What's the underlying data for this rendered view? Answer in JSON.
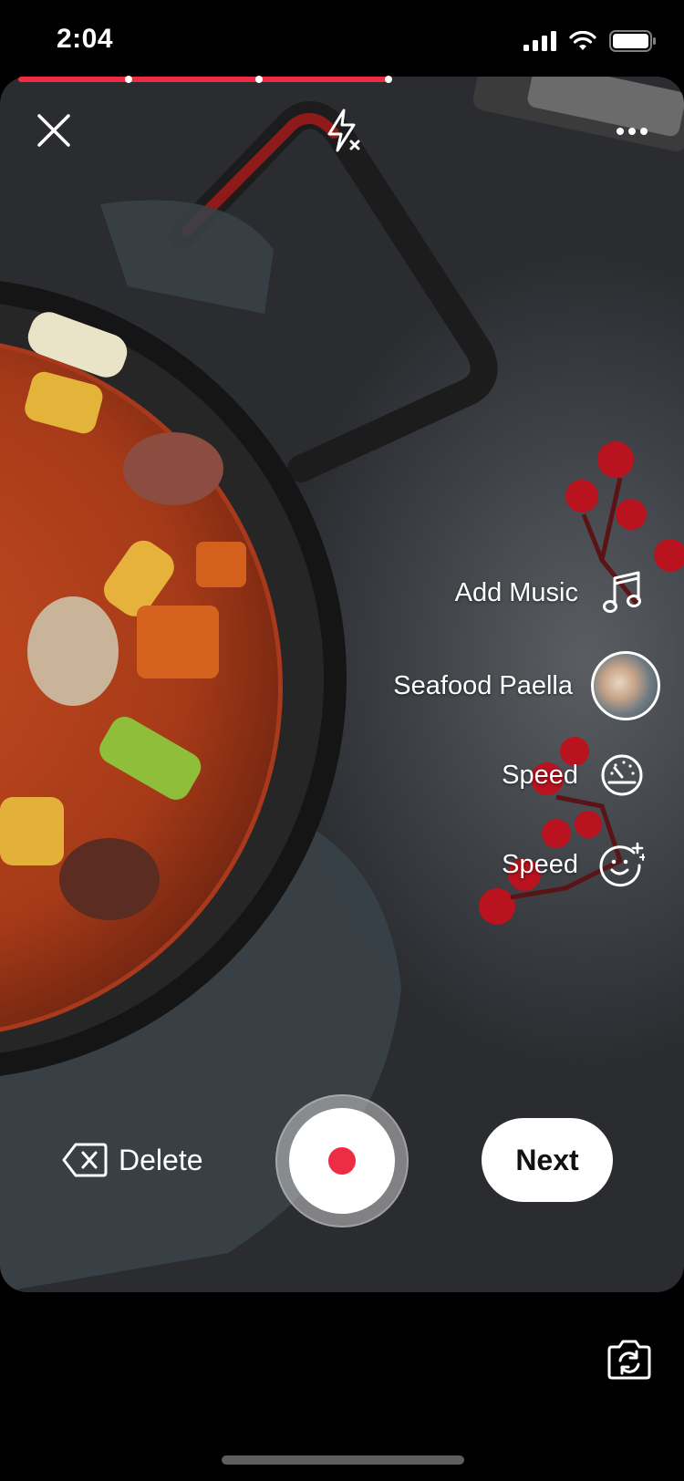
{
  "status_bar": {
    "time": "2:04"
  },
  "recording": {
    "progress_color": "#ee2c44",
    "segments_recorded": 3
  },
  "top_bar": {
    "close_icon": "close-icon",
    "flash_icon": "flash-off-icon",
    "more_icon": "more-dots-icon"
  },
  "side_menu": {
    "items": [
      {
        "label": "Add Music",
        "icon": "music-note-icon"
      },
      {
        "label": "Seafood Paella",
        "icon": "recipe-thumbnail"
      },
      {
        "label": "Speed",
        "icon": "speedometer-icon"
      },
      {
        "label": "Speed",
        "icon": "face-sparkle-icon"
      }
    ]
  },
  "bottom_controls": {
    "delete_label": "Delete",
    "next_label": "Next",
    "record_color": "#ee2c44"
  },
  "camera_flip_icon": "camera-flip-icon"
}
